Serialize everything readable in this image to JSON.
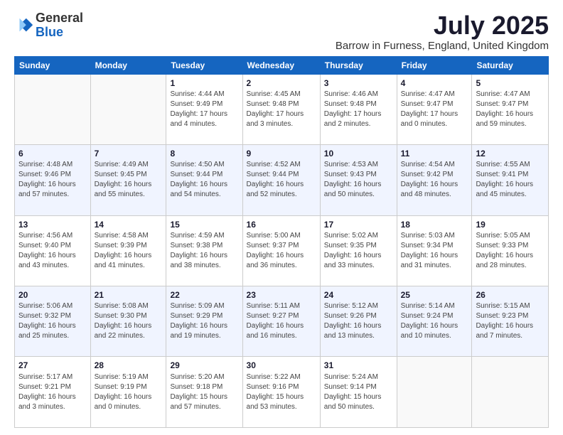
{
  "header": {
    "logo_general": "General",
    "logo_blue": "Blue",
    "month": "July 2025",
    "location": "Barrow in Furness, England, United Kingdom"
  },
  "days_of_week": [
    "Sunday",
    "Monday",
    "Tuesday",
    "Wednesday",
    "Thursday",
    "Friday",
    "Saturday"
  ],
  "weeks": [
    [
      {
        "day": "",
        "info": ""
      },
      {
        "day": "",
        "info": ""
      },
      {
        "day": "1",
        "info": "Sunrise: 4:44 AM\nSunset: 9:49 PM\nDaylight: 17 hours\nand 4 minutes."
      },
      {
        "day": "2",
        "info": "Sunrise: 4:45 AM\nSunset: 9:48 PM\nDaylight: 17 hours\nand 3 minutes."
      },
      {
        "day": "3",
        "info": "Sunrise: 4:46 AM\nSunset: 9:48 PM\nDaylight: 17 hours\nand 2 minutes."
      },
      {
        "day": "4",
        "info": "Sunrise: 4:47 AM\nSunset: 9:47 PM\nDaylight: 17 hours\nand 0 minutes."
      },
      {
        "day": "5",
        "info": "Sunrise: 4:47 AM\nSunset: 9:47 PM\nDaylight: 16 hours\nand 59 minutes."
      }
    ],
    [
      {
        "day": "6",
        "info": "Sunrise: 4:48 AM\nSunset: 9:46 PM\nDaylight: 16 hours\nand 57 minutes."
      },
      {
        "day": "7",
        "info": "Sunrise: 4:49 AM\nSunset: 9:45 PM\nDaylight: 16 hours\nand 55 minutes."
      },
      {
        "day": "8",
        "info": "Sunrise: 4:50 AM\nSunset: 9:44 PM\nDaylight: 16 hours\nand 54 minutes."
      },
      {
        "day": "9",
        "info": "Sunrise: 4:52 AM\nSunset: 9:44 PM\nDaylight: 16 hours\nand 52 minutes."
      },
      {
        "day": "10",
        "info": "Sunrise: 4:53 AM\nSunset: 9:43 PM\nDaylight: 16 hours\nand 50 minutes."
      },
      {
        "day": "11",
        "info": "Sunrise: 4:54 AM\nSunset: 9:42 PM\nDaylight: 16 hours\nand 48 minutes."
      },
      {
        "day": "12",
        "info": "Sunrise: 4:55 AM\nSunset: 9:41 PM\nDaylight: 16 hours\nand 45 minutes."
      }
    ],
    [
      {
        "day": "13",
        "info": "Sunrise: 4:56 AM\nSunset: 9:40 PM\nDaylight: 16 hours\nand 43 minutes."
      },
      {
        "day": "14",
        "info": "Sunrise: 4:58 AM\nSunset: 9:39 PM\nDaylight: 16 hours\nand 41 minutes."
      },
      {
        "day": "15",
        "info": "Sunrise: 4:59 AM\nSunset: 9:38 PM\nDaylight: 16 hours\nand 38 minutes."
      },
      {
        "day": "16",
        "info": "Sunrise: 5:00 AM\nSunset: 9:37 PM\nDaylight: 16 hours\nand 36 minutes."
      },
      {
        "day": "17",
        "info": "Sunrise: 5:02 AM\nSunset: 9:35 PM\nDaylight: 16 hours\nand 33 minutes."
      },
      {
        "day": "18",
        "info": "Sunrise: 5:03 AM\nSunset: 9:34 PM\nDaylight: 16 hours\nand 31 minutes."
      },
      {
        "day": "19",
        "info": "Sunrise: 5:05 AM\nSunset: 9:33 PM\nDaylight: 16 hours\nand 28 minutes."
      }
    ],
    [
      {
        "day": "20",
        "info": "Sunrise: 5:06 AM\nSunset: 9:32 PM\nDaylight: 16 hours\nand 25 minutes."
      },
      {
        "day": "21",
        "info": "Sunrise: 5:08 AM\nSunset: 9:30 PM\nDaylight: 16 hours\nand 22 minutes."
      },
      {
        "day": "22",
        "info": "Sunrise: 5:09 AM\nSunset: 9:29 PM\nDaylight: 16 hours\nand 19 minutes."
      },
      {
        "day": "23",
        "info": "Sunrise: 5:11 AM\nSunset: 9:27 PM\nDaylight: 16 hours\nand 16 minutes."
      },
      {
        "day": "24",
        "info": "Sunrise: 5:12 AM\nSunset: 9:26 PM\nDaylight: 16 hours\nand 13 minutes."
      },
      {
        "day": "25",
        "info": "Sunrise: 5:14 AM\nSunset: 9:24 PM\nDaylight: 16 hours\nand 10 minutes."
      },
      {
        "day": "26",
        "info": "Sunrise: 5:15 AM\nSunset: 9:23 PM\nDaylight: 16 hours\nand 7 minutes."
      }
    ],
    [
      {
        "day": "27",
        "info": "Sunrise: 5:17 AM\nSunset: 9:21 PM\nDaylight: 16 hours\nand 3 minutes."
      },
      {
        "day": "28",
        "info": "Sunrise: 5:19 AM\nSunset: 9:19 PM\nDaylight: 16 hours\nand 0 minutes."
      },
      {
        "day": "29",
        "info": "Sunrise: 5:20 AM\nSunset: 9:18 PM\nDaylight: 15 hours\nand 57 minutes."
      },
      {
        "day": "30",
        "info": "Sunrise: 5:22 AM\nSunset: 9:16 PM\nDaylight: 15 hours\nand 53 minutes."
      },
      {
        "day": "31",
        "info": "Sunrise: 5:24 AM\nSunset: 9:14 PM\nDaylight: 15 hours\nand 50 minutes."
      },
      {
        "day": "",
        "info": ""
      },
      {
        "day": "",
        "info": ""
      }
    ]
  ]
}
